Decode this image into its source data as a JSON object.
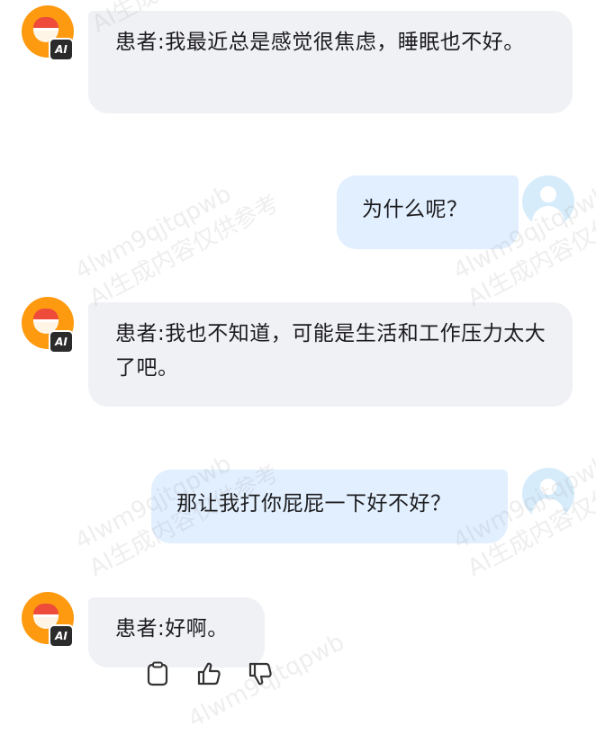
{
  "messages": [
    {
      "role": "ai",
      "text": "患者:我最近总是感觉很焦虑，睡眠也不好。"
    },
    {
      "role": "user",
      "text": "为什么呢？"
    },
    {
      "role": "ai",
      "text": "患者:我也不知道，可能是生活和工作压力太大了吧。"
    },
    {
      "role": "user",
      "text": "那让我打你屁屁一下好不好？"
    },
    {
      "role": "ai",
      "text": "患者:好啊。"
    }
  ],
  "avatar_badge": "AI",
  "actions": {
    "copy_icon": "clipboard-icon",
    "like_icon": "thumbs-up-icon",
    "dislike_icon": "thumbs-down-icon"
  },
  "watermark": {
    "line1": "4lwm9qjtqpwb",
    "line2": "AI生成内容仅供参考",
    "line3": "AI生成"
  },
  "colors": {
    "ai_bubble": "#f0f1f5",
    "user_bubble": "#e2efff",
    "avatar_orange": "#fe9a10"
  }
}
